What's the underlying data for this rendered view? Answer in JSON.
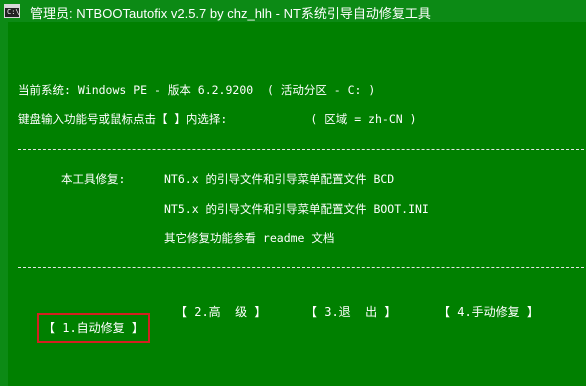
{
  "window": {
    "title": "管理员: NTBOOTautofix v2.5.7 by chz_hlh - NT系统引导自动修复工具",
    "icon_label": "C:\\"
  },
  "console": {
    "system_line": "当前系统: Windows PE - 版本 6.2.9200  ( 活动分区 - C: )",
    "prompt_line": "键盘输入功能号或鼠标点击【 】内选择:            ( 区域 = zh-CN )",
    "repair_label": "本工具修复:",
    "repair_lines": [
      "NT6.x 的引导文件和引导菜单配置文件 BCD",
      "NT5.x 的引导文件和引导菜单配置文件 BOOT.INI",
      "其它修复功能参看 readme 文档"
    ]
  },
  "menu": [
    {
      "label": "【 1.自动修复 】"
    },
    {
      "label": "【 2.高  级 】"
    },
    {
      "label": "【 3.退  出 】"
    },
    {
      "label": "【 4.手动修复 】"
    }
  ],
  "colors": {
    "background": "#008000",
    "selection_border": "#d42020",
    "text": "#ffffff"
  }
}
